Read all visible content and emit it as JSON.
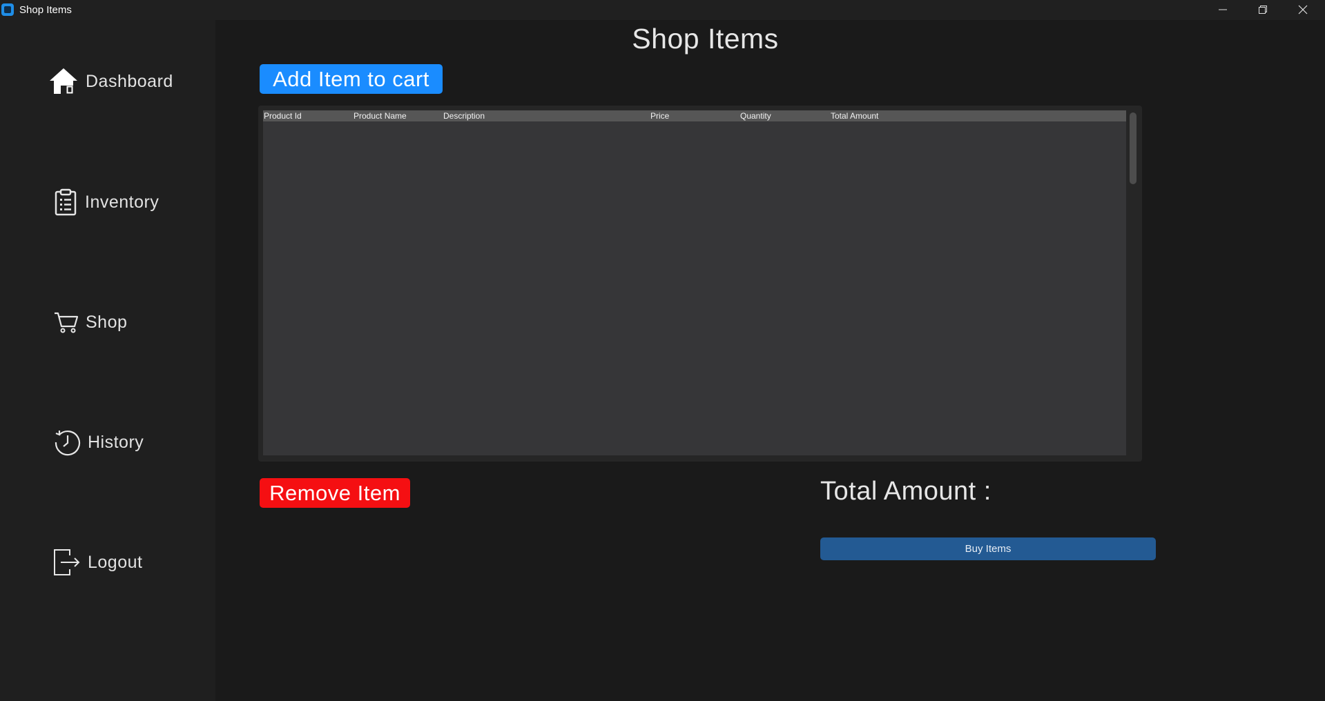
{
  "window": {
    "title": "Shop Items",
    "controls": [
      "minimize-icon",
      "restore-icon",
      "close-icon"
    ]
  },
  "sidebar": {
    "items": [
      {
        "label": "Dashboard",
        "icon": "home-icon"
      },
      {
        "label": "Inventory",
        "icon": "clipboard-icon"
      },
      {
        "label": "Shop",
        "icon": "cart-icon"
      },
      {
        "label": "History",
        "icon": "history-icon"
      },
      {
        "label": "Logout",
        "icon": "logout-icon"
      }
    ]
  },
  "main": {
    "title": "Shop Items",
    "add_button": "Add Item to cart",
    "table": {
      "columns": [
        "Product Id",
        "Product Name",
        "Description",
        "Price",
        "Quantity",
        "Total Amount"
      ],
      "rows": []
    },
    "remove_button": "Remove Item",
    "total_label": "Total Amount :",
    "buy_button": "Buy Items"
  },
  "colors": {
    "accent_blue": "#1a8cff",
    "danger_red": "#f50f12",
    "buy_blue": "#235a93",
    "background": "#1a1a1a"
  }
}
